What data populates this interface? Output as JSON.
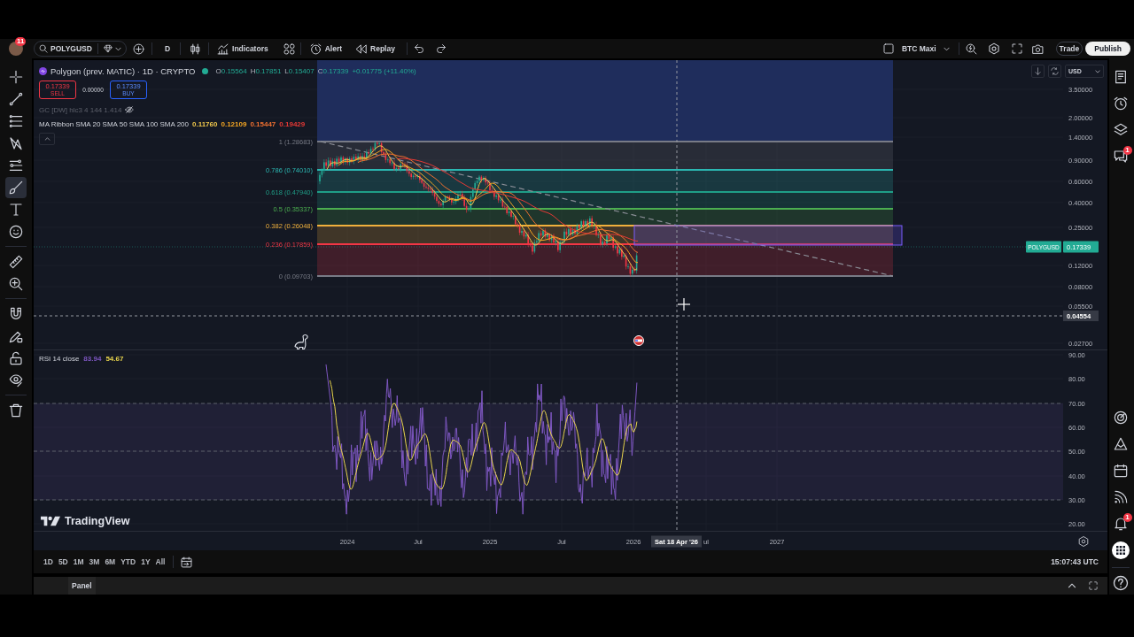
{
  "toolbar": {
    "notification_count": "11",
    "symbol": "POLYGUSD",
    "interval": "D",
    "actions": [
      "Indicators",
      "Alert",
      "Replay"
    ],
    "layout_name": "BTC Maxi",
    "trade_button": "Trade",
    "publish_button": "Publish"
  },
  "drawing_tools": [
    {
      "selected": false
    },
    {
      "selected": false
    },
    {
      "selected": false
    },
    {
      "selected": false
    },
    {
      "selected": false
    },
    {
      "selected": true
    },
    {
      "selected": false
    },
    {
      "selected": false
    },
    {
      "selected": false
    },
    {
      "selected": false
    },
    {
      "selected": false
    },
    {
      "selected": false
    },
    {
      "selected": false
    },
    {
      "selected": false
    },
    {
      "selected": false
    }
  ],
  "legend": {
    "title": "Polygon (prev. MATIC) · 1D · CRYPTO",
    "market_open": true,
    "ohlc": [
      {
        "label": "O",
        "value": "0.15564"
      },
      {
        "label": "H",
        "value": "0.17851"
      },
      {
        "label": "L",
        "value": "0.15407"
      },
      {
        "label": "C",
        "value": "0.17339"
      }
    ],
    "change": "+0.01775 (+11.40%)",
    "sell": {
      "price": "0.17339",
      "label": "SELL"
    },
    "spread": "0.00000",
    "buy": {
      "price": "0.17339",
      "label": "BUY"
    },
    "indicators": [
      {
        "name": "GC [DW] hlc3 4 144 1.414",
        "hidden": true
      },
      {
        "name": "MA Ribbon SMA 20 SMA 50 SMA 100 SMA 200",
        "hidden": false,
        "values": [
          {
            "text": "0.11760",
            "color": "#f2c94c"
          },
          {
            "text": "0.12109",
            "color": "#f5a623"
          },
          {
            "text": "0.15447",
            "color": "#f07030"
          },
          {
            "text": "0.19429",
            "color": "#e53935"
          }
        ]
      }
    ]
  },
  "fib_levels": [
    {
      "label": "1 (1.28683)",
      "color": "#787b86"
    },
    {
      "label": "0.786 (0.74010)",
      "color": "#2bb7b2"
    },
    {
      "label": "0.618 (0.47940)",
      "color": "#1f9e87"
    },
    {
      "label": "0.5 (0.35337)",
      "color": "#4caf50"
    },
    {
      "label": "0.382 (0.26048)",
      "color": "#f0b03c"
    },
    {
      "label": "0.236 (0.17859)",
      "color": "#f23645"
    },
    {
      "label": "0 (0.09703)",
      "color": "#787b86"
    }
  ],
  "price_axis": {
    "currency": "USD",
    "labels": [
      "3.50000",
      "2.00000",
      "1.40000",
      "0.90000",
      "0.60000",
      "0.40000",
      "0.25000",
      "0.12000",
      "0.08000",
      "0.05500",
      "0.02700"
    ],
    "symbol_tag": "POLYGUSD",
    "last_price": "0.17339",
    "crosshair_price": "0.04554"
  },
  "rsi": {
    "name": "RSI 14 close",
    "values": [
      {
        "text": "83.94",
        "color": "#7e57c2"
      },
      {
        "text": "54.67",
        "color": "#e8d44d"
      }
    ],
    "axis_labels": [
      "90.00",
      "80.00",
      "70.00",
      "60.00",
      "50.00",
      "40.00",
      "30.00",
      "20.00"
    ]
  },
  "chart_logo": "TradingView",
  "time_axis": {
    "labels": [
      "2024",
      "Jul",
      "2025",
      "Jul",
      "2026",
      "ul",
      "2027"
    ],
    "crosshair_time": "Sat 18 Apr '26"
  },
  "bottom_bar": {
    "ranges": [
      "1D",
      "5D",
      "1M",
      "3M",
      "6M",
      "YTD",
      "1Y",
      "All"
    ],
    "clock": "15:07:43 UTC",
    "panel_tab": "Panel"
  },
  "right_sidebar": {
    "chat_badge": "1",
    "alerts_badge": "1"
  }
}
